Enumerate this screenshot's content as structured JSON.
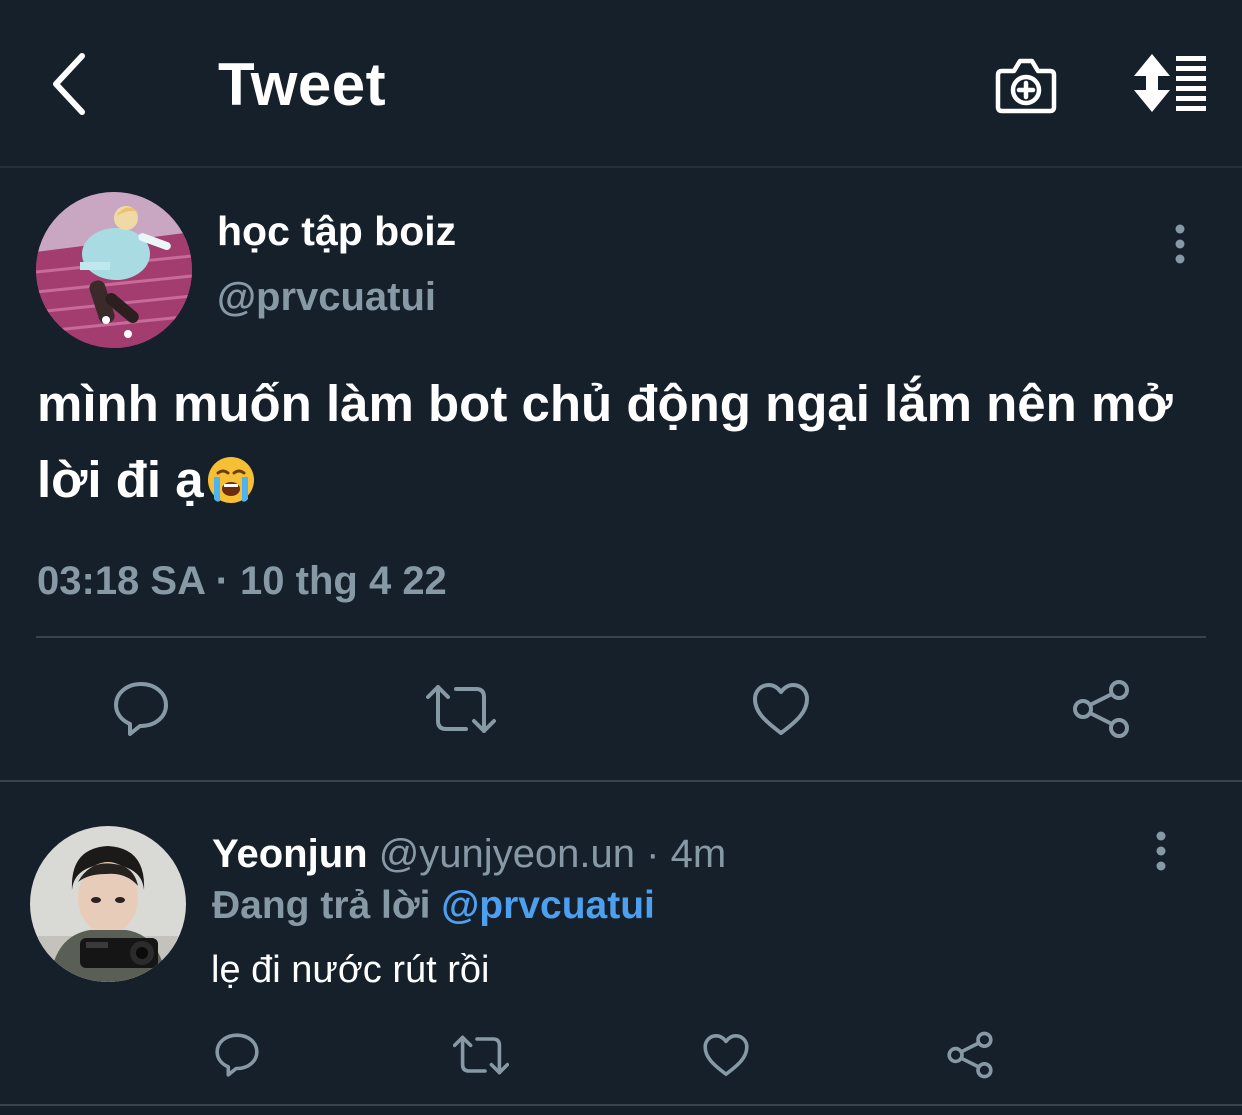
{
  "header": {
    "title": "Tweet",
    "back_icon": "chevron-left-icon",
    "camera_icon": "camera-plus-icon",
    "sort_icon": "sort-icon"
  },
  "main_tweet": {
    "display_name": "học tập boiz",
    "handle": "@prvcuatui",
    "text": "mình muốn làm bot chủ động ngại lắm nên mở lời đi ạ",
    "emoji": "loudly-crying-face",
    "timestamp": "03:18 SA · 10 thg 4 22",
    "actions": [
      "reply-icon",
      "retweet-icon",
      "like-icon",
      "share-icon"
    ]
  },
  "reply": {
    "display_name": "Yeonjun",
    "meta": "@yunjyeon.un · 4m",
    "replying_to_label": "Đang trả lời",
    "replying_to_handle": "@prvcuatui",
    "text": "lẹ đi nước rút rồi",
    "actions": [
      "reply-icon",
      "retweet-icon",
      "like-icon",
      "share-icon"
    ]
  },
  "colors": {
    "background": "#15202b",
    "secondary_text": "#8899a6",
    "link": "#4da0f0",
    "divider": "#38444d"
  }
}
